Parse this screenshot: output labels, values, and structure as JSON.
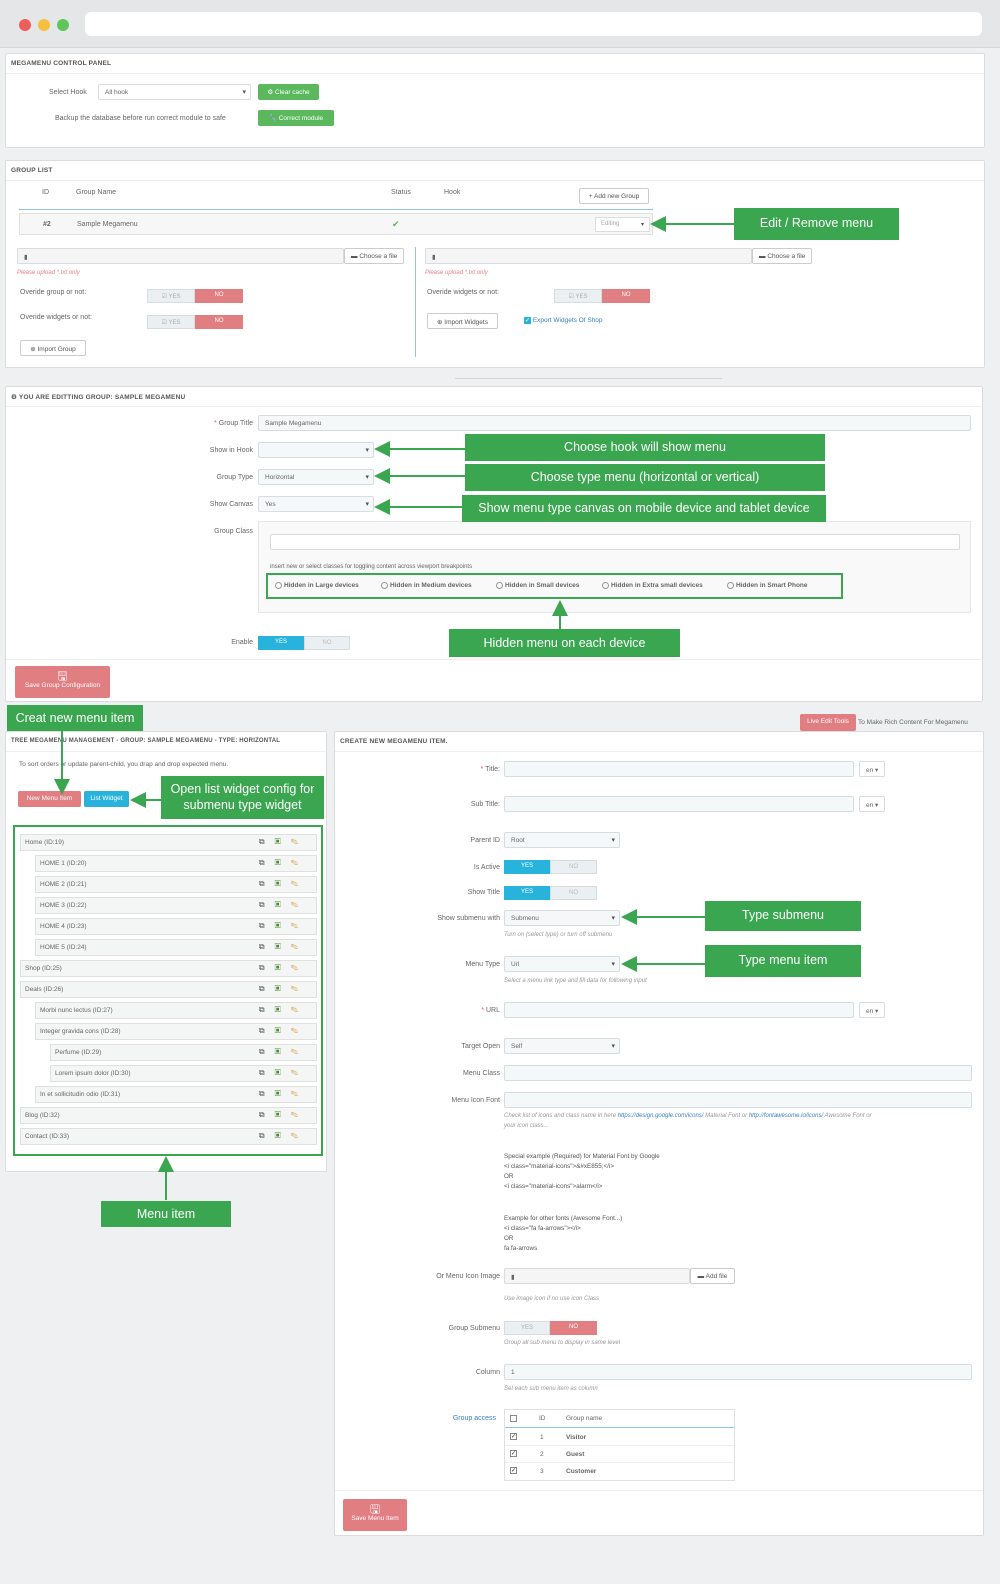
{
  "control_panel": {
    "title": "MEGAMENU CONTROL PANEL",
    "select_hook_label": "Select Hook",
    "select_hook_value": "All hook",
    "clear_cache": "Clear cache",
    "backup_text": "Backup the database before run correct module to safe",
    "correct_module": "Correct module"
  },
  "group_list": {
    "title": "GROUP LIST",
    "columns": [
      "ID",
      "Group Name",
      "Status",
      "Hook"
    ],
    "add_group": "Add new Group",
    "row": {
      "id": "#2",
      "name": "Sample Megamenu",
      "status": "✔",
      "action": "Editing"
    },
    "choose_file": "Choose a file",
    "upload_hint": "Please upload *.txt only",
    "override_group": "Overide group or not:",
    "override_widgets": "Overide widgets or not:",
    "yes": "YES",
    "no": "NO",
    "import_group": "Import Group",
    "import_widgets": "Import Widgets",
    "export_widgets": "Export Widgets Of Shop"
  },
  "edit_group": {
    "title": "YOU ARE EDITTING GROUP: SAMPLE MEGAMENU",
    "group_title_label": "Group Title",
    "group_title_value": "Sample Megamenu",
    "show_in_hook_label": "Show in Hook",
    "show_in_hook_value": "",
    "group_type_label": "Group Type",
    "group_type_value": "Horizontal",
    "show_canvas_label": "Show Canvas",
    "show_canvas_value": "Yes",
    "group_class_label": "Group Class",
    "group_class_hint": "insert new or select classes for toggling content across viewport breakpoints",
    "devices": [
      "Hidden in Large devices",
      "Hidden in Medium devices",
      "Hidden in Small devices",
      "Hidden in Extra small devices",
      "Hidden in Smart Phone"
    ],
    "enable_label": "Enable",
    "yes": "YES",
    "no": "NO",
    "save": "Save Group Configuration"
  },
  "tree": {
    "title": "TREE MEGAMENU MANAGEMENT - GROUP: SAMPLE MEGAMENU - TYPE: HORIZONTAL",
    "hint": "To sort orders or update parent-child, you drap and drop expected menu.",
    "new_item": "New Menu Item",
    "list_widget": "List Widget",
    "items": [
      {
        "label": "Home (ID:19)",
        "level": 0
      },
      {
        "label": "HOME 1 (ID:20)",
        "level": 1
      },
      {
        "label": "HOME 2 (ID:21)",
        "level": 1
      },
      {
        "label": "HOME 3 (ID:22)",
        "level": 1
      },
      {
        "label": "HOME 4 (ID:23)",
        "level": 1
      },
      {
        "label": "HOME 5 (ID:24)",
        "level": 1
      },
      {
        "label": "Shop (ID:25)",
        "level": 0
      },
      {
        "label": "Deals (ID:26)",
        "level": 0
      },
      {
        "label": "Morbi nunc lectus (ID:27)",
        "level": 1
      },
      {
        "label": "Integer gravida cons (ID:28)",
        "level": 1
      },
      {
        "label": "Perfume (ID:29)",
        "level": 2
      },
      {
        "label": "Lorem ipsum dolor (ID:30)",
        "level": 2
      },
      {
        "label": "In et sollicitudin odio (ID:31)",
        "level": 1
      },
      {
        "label": "Blog (ID:32)",
        "level": 0
      },
      {
        "label": "Contact (ID:33)",
        "level": 0
      }
    ]
  },
  "live_edit": {
    "button": "Live Edit Tools",
    "text": "To Make Rich Content For Megamenu"
  },
  "create_item": {
    "title": "CREATE NEW MEGAMENU ITEM.",
    "title_label": "Title:",
    "subtitle_label": "Sub Title:",
    "lang": "en",
    "parent_label": "Parent ID",
    "parent_value": "Root",
    "active_label": "Is Active",
    "show_title_label": "Show Title",
    "submenu_label": "Show submenu with",
    "submenu_value": "Submenu",
    "submenu_hint": "Turn on (select type) or turn off submenu",
    "menu_type_label": "Menu Type",
    "menu_type_value": "Url",
    "menu_type_hint": "Select a menu link type and fill data for following input",
    "url_label": "URL",
    "target_label": "Target Open",
    "target_value": "Self",
    "class_label": "Menu Class",
    "icon_font_label": "Menu Icon Font",
    "icon_hint_a": "Check list of icons and class name in here ",
    "icon_link_1": "https://design.google.com/icons/",
    "icon_hint_b": " Material Font or ",
    "icon_link_2": "http://fontawesome.io/icons/",
    "icon_hint_c": " Awesome Font or",
    "icon_hint_d": "your icon class...",
    "special_example": "Special example (Required) for Material Font by Google\n<i class=\"material-icons\">&#xE855;</i>\nOR\n<i class=\"material-icons\">alarm</i>",
    "other_example": "Example for other fonts (Awesome Font...)\n<i class=\"fa fa-arrows\"></i>\nOR\nfa fa-arrows",
    "icon_image_label": "Or Menu Icon Image",
    "add_file": "Add file",
    "icon_image_hint": "Use image icon if no use icon Class",
    "group_submenu_label": "Group Submenu",
    "group_submenu_hint": "Group all sub menu to display in same level",
    "column_label": "Column",
    "column_value": "1",
    "column_hint": "Set each sub menu item as column",
    "access_label": "Group access",
    "access_cols": [
      "ID",
      "Group name"
    ],
    "access_rows": [
      {
        "id": "1",
        "name": "Visitor"
      },
      {
        "id": "2",
        "name": "Guest"
      },
      {
        "id": "3",
        "name": "Customer"
      }
    ],
    "yes": "YES",
    "no": "NO",
    "save": "Save Menu Item"
  },
  "annotations": {
    "edit_remove": "Edit / Remove menu",
    "choose_hook": "Choose hook will show menu",
    "choose_type": "Choose type menu (horizontal or vertical)",
    "show_canvas": "Show menu type canvas on mobile device and tablet device",
    "hidden_device": "Hidden menu on each device",
    "create_new": "Creat new menu item",
    "open_widget_1": "Open list widget config for",
    "open_widget_2": "submenu type widget",
    "menu_item": "Menu item",
    "type_submenu": "Type submenu",
    "type_menu_item": "Type menu item"
  },
  "colors": {
    "green": "#3aa650",
    "button_green": "#5cb85c",
    "pink": "#e07e82",
    "blue": "#28b3dd"
  }
}
